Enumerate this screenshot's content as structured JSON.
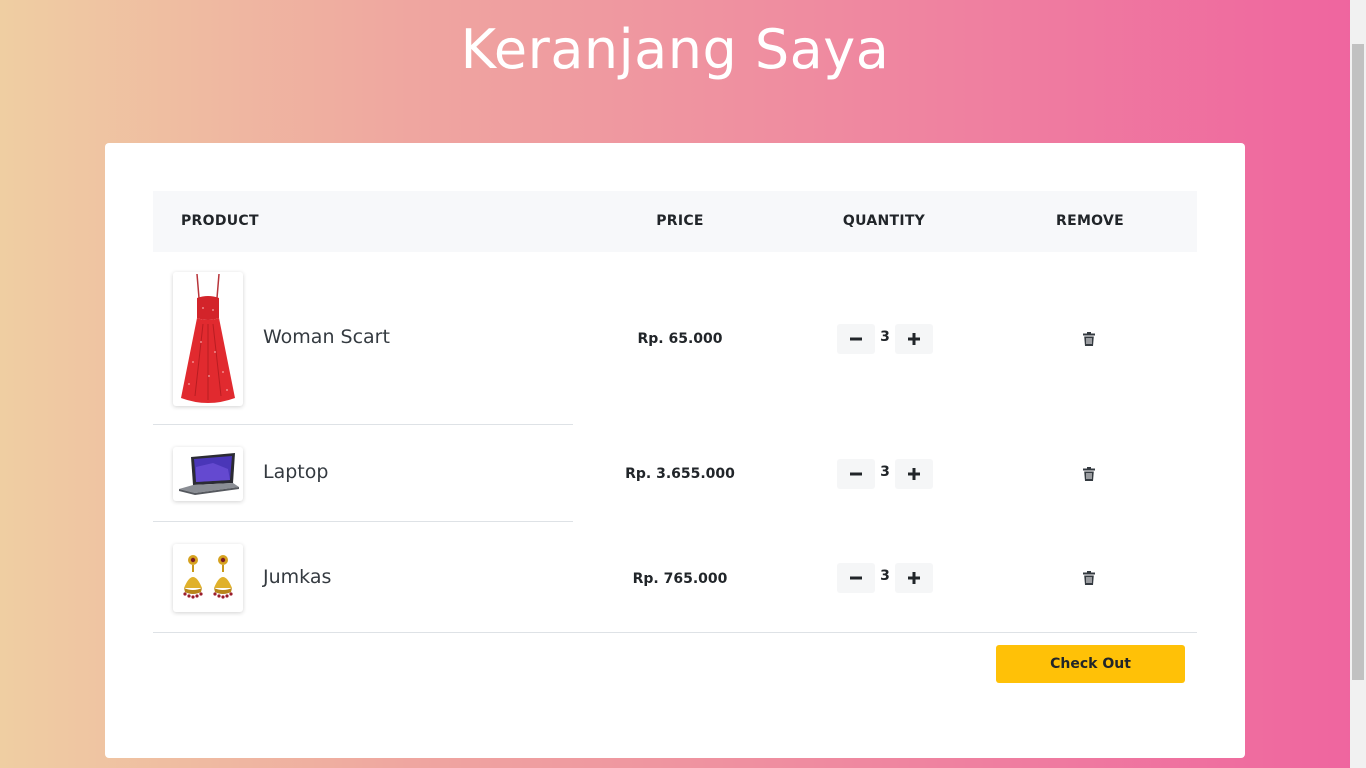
{
  "page": {
    "title": "Keranjang Saya"
  },
  "colors": {
    "accent": "#ffc107",
    "header_bg": "#f7f8fa",
    "text": "#212529"
  },
  "table": {
    "headers": {
      "product": "PRODUCT",
      "price": "PRICE",
      "quantity": "QUANTITY",
      "remove": "REMOVE"
    },
    "items": [
      {
        "name": "Woman Scart",
        "price": "Rp. 65.000",
        "quantity": "3",
        "image_icon": "red-dress-image"
      },
      {
        "name": "Laptop",
        "price": "Rp. 3.655.000",
        "quantity": "3",
        "image_icon": "laptop-image"
      },
      {
        "name": "Jumkas",
        "price": "Rp. 765.000",
        "quantity": "3",
        "image_icon": "earrings-image"
      }
    ]
  },
  "actions": {
    "checkout_label": "Check Out"
  },
  "icons": {
    "decrease": "minus-icon",
    "increase": "plus-icon",
    "remove": "trash-icon"
  }
}
